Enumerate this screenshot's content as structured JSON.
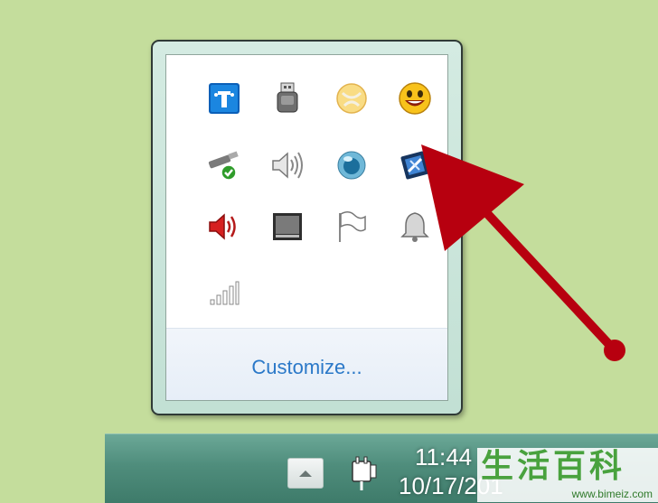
{
  "tray_popup": {
    "icons": [
      {
        "name": "network-connect-icon"
      },
      {
        "name": "usb-device-icon"
      },
      {
        "name": "messenger-icon"
      },
      {
        "name": "smiley-icon"
      },
      {
        "name": "safely-remove-hardware-icon"
      },
      {
        "name": "speaker-volume-icon"
      },
      {
        "name": "blue-orb-icon"
      },
      {
        "name": "utility-icon"
      },
      {
        "name": "volume-red-speaker-icon"
      },
      {
        "name": "display-icon"
      },
      {
        "name": "action-center-flag-icon"
      },
      {
        "name": "notification-bell-icon"
      },
      {
        "name": "signal-strength-icon"
      }
    ],
    "customize_label": "Customize..."
  },
  "taskbar": {
    "show_hidden_label": "",
    "time": "11:44",
    "date": "10/17/201"
  },
  "watermark": {
    "chars": [
      "生",
      "活",
      "百",
      "科"
    ],
    "url": "www.bimeiz.com"
  },
  "colors": {
    "background": "#c4dd9c",
    "arrow": "#b7000f",
    "link": "#2a78c8",
    "taskbar": "#4f8d7c"
  }
}
